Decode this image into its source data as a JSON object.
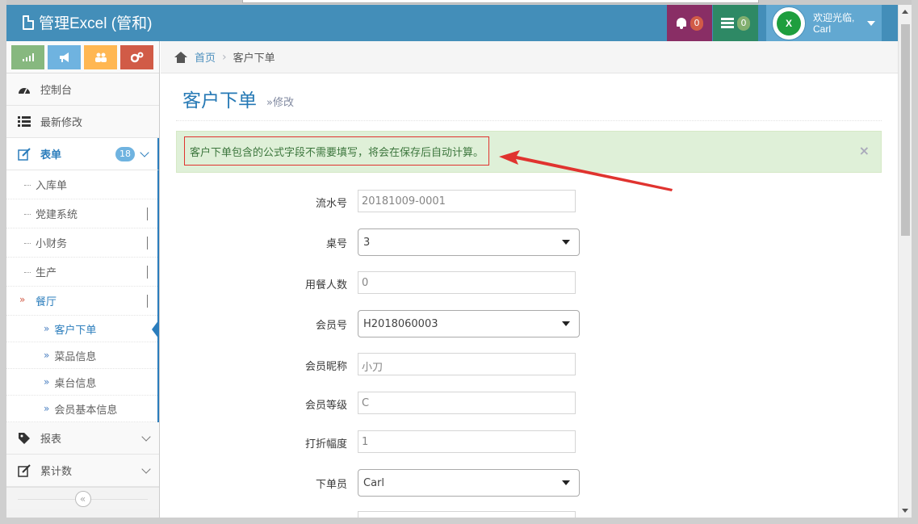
{
  "navbar": {
    "brand": "管理Excel (管和)",
    "notifications_count": "0",
    "tasks_count": "0",
    "user_greeting": "欢迎光临,",
    "user_name": "Carl",
    "avatar_text": "X"
  },
  "sidebar": {
    "items": {
      "dashboard": "控制台",
      "recent": "最新修改",
      "forms": "表单",
      "forms_badge": "18",
      "reports": "报表",
      "counters": "累计数"
    },
    "forms_sub": {
      "inbound": "入库单",
      "party": "党建系统",
      "finance": "小财务",
      "production": "生产",
      "restaurant": "餐厅"
    },
    "restaurant_sub": {
      "order": "客户下单",
      "dishes": "菜品信息",
      "tables": "桌台信息",
      "members": "会员基本信息"
    },
    "collapse_glyph": "«"
  },
  "breadcrumb": {
    "home": "首页",
    "current": "客户下单"
  },
  "page": {
    "title": "客户下单",
    "subtitle": "»修改",
    "alert": "客户下单包含的公式字段不需要填写，将会在保存后自动计算。",
    "alert_close": "×"
  },
  "form": {
    "serial_label": "流水号",
    "serial_value": "20181009-0001",
    "table_label": "桌号",
    "table_value": "3",
    "guests_label": "用餐人数",
    "guests_value": "0",
    "member_id_label": "会员号",
    "member_id_value": "H2018060003",
    "nickname_label": "会员昵称",
    "nickname_value": "小刀",
    "level_label": "会员等级",
    "level_value": "C",
    "discount_label": "打折幅度",
    "discount_value": "1",
    "staff_label": "下单员",
    "staff_value": "Carl"
  },
  "colors": {
    "navbar": "#438eb9",
    "accent": "#2b7dbc",
    "alert_bg": "#dff0d8",
    "annotation": "#e0332f"
  }
}
